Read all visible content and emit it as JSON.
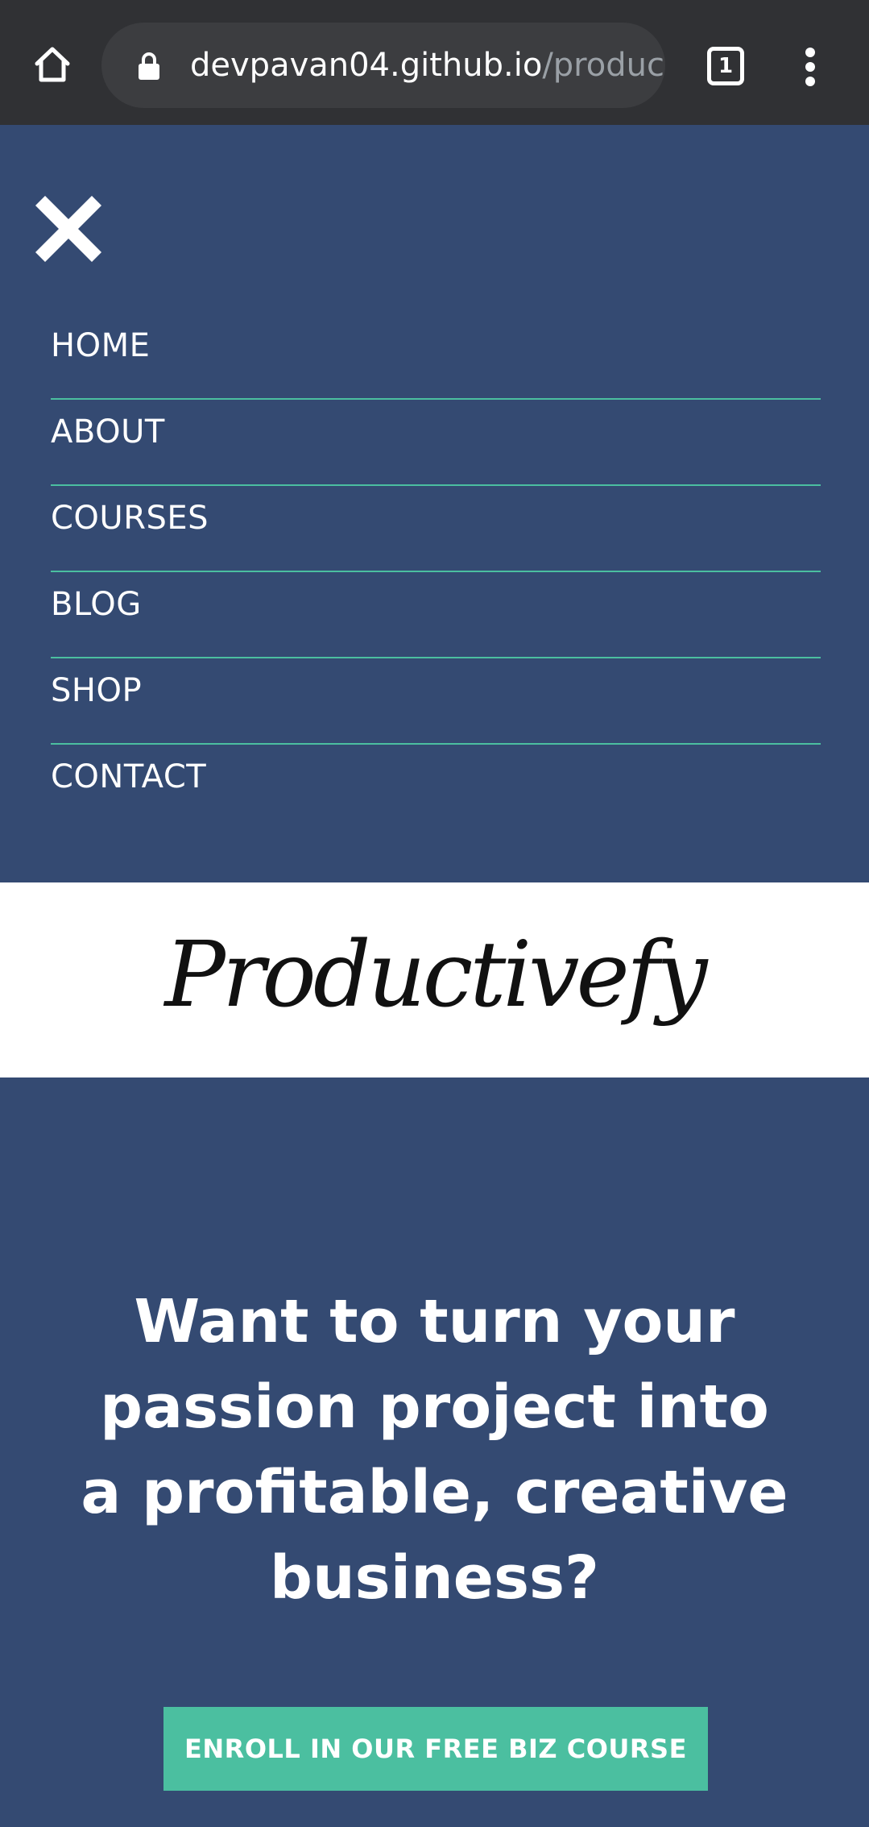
{
  "browser": {
    "url_host": "devpavan04.github.io",
    "url_path": "/product",
    "tab_count": "1",
    "icons": {
      "home": "home-icon",
      "lock": "lock-icon",
      "tabs": "tab-switcher-icon",
      "menu": "kebab-menu-icon"
    }
  },
  "nav": {
    "close_icon": "close-icon",
    "items": [
      {
        "label": "HOME"
      },
      {
        "label": "ABOUT"
      },
      {
        "label": "COURSES"
      },
      {
        "label": "BLOG"
      },
      {
        "label": "SHOP"
      },
      {
        "label": "CONTACT"
      }
    ]
  },
  "brand": {
    "logo_text": "Productivefy"
  },
  "hero": {
    "heading": "Want to turn your passion project into a profitable, creative business?",
    "cta_label": "ENROLL IN OUR FREE BIZ COURSE"
  },
  "colors": {
    "background": "#344a72",
    "accent": "#4bbfa0",
    "chrome": "#303134",
    "logo_band": "#ffffff"
  }
}
